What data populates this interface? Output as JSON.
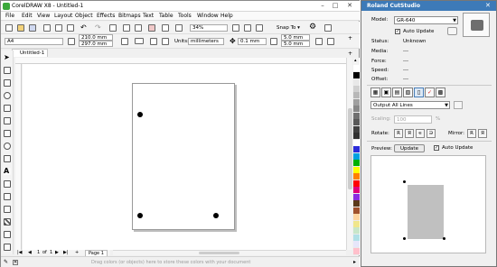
{
  "corel": {
    "title": "CorelDRAW X8 - Untitled-1",
    "menus": [
      "File",
      "Edit",
      "View",
      "Layout",
      "Object",
      "Effects",
      "Bitmaps",
      "Text",
      "Table",
      "Tools",
      "Window",
      "Help"
    ],
    "toolbar": {
      "zoom": "34%",
      "snap_to": "Snap To"
    },
    "propbar": {
      "paper": "A4",
      "width": "210.0 mm",
      "height": "297.0 mm",
      "units_label": "Units:",
      "units": "millimeters",
      "nudge": "0.1 mm",
      "dup_x": "5.0 mm",
      "dup_y": "5.0 mm"
    },
    "doc_tab": "Untitled-1",
    "page_nav": {
      "current": "1",
      "of": "of",
      "total": "1",
      "page_tab": "Page 1"
    },
    "status_hint": "Drag colors (or objects) here to store these colors with your document",
    "palette": [
      "#ffffff",
      "#000000",
      "#e8e8e8",
      "#d0d0d0",
      "#b8b8b8",
      "#a0a0a0",
      "#888888",
      "#707070",
      "#585858",
      "#404040",
      "#303030",
      "#ffffff",
      "#2b2bd9",
      "#00a0e0",
      "#00b000",
      "#ffff00",
      "#ff8000",
      "#ff0000",
      "#e0007a",
      "#8a2be2",
      "#5b3a1a",
      "#a0522d",
      "#ffd5a0",
      "#f0e68c",
      "#c8e6c9",
      "#b0e0e6",
      "#e6e6fa",
      "#ffc0cb"
    ]
  },
  "roland": {
    "title": "Roland CutStudio",
    "model_label": "Model:",
    "model": "GR-640",
    "auto_update_label": "Auto Update",
    "status_label": "Status:",
    "status_value": "Unknown",
    "media_label": "Media:",
    "media_value": "---",
    "force_label": "Force:",
    "force_value": "---",
    "speed_label": "Speed:",
    "speed_value": "---",
    "offset_label": "Offset:",
    "offset_value": "---",
    "output_select": "Output All Lines",
    "scaling_label": "Scaling:",
    "scaling_value": "100",
    "scaling_unit": "%",
    "rotate_label": "Rotate:",
    "mirror_label": "Mirror:",
    "preview_label": "Preview:",
    "update_button": "Update",
    "preview_auto_update_label": "Auto Update"
  }
}
